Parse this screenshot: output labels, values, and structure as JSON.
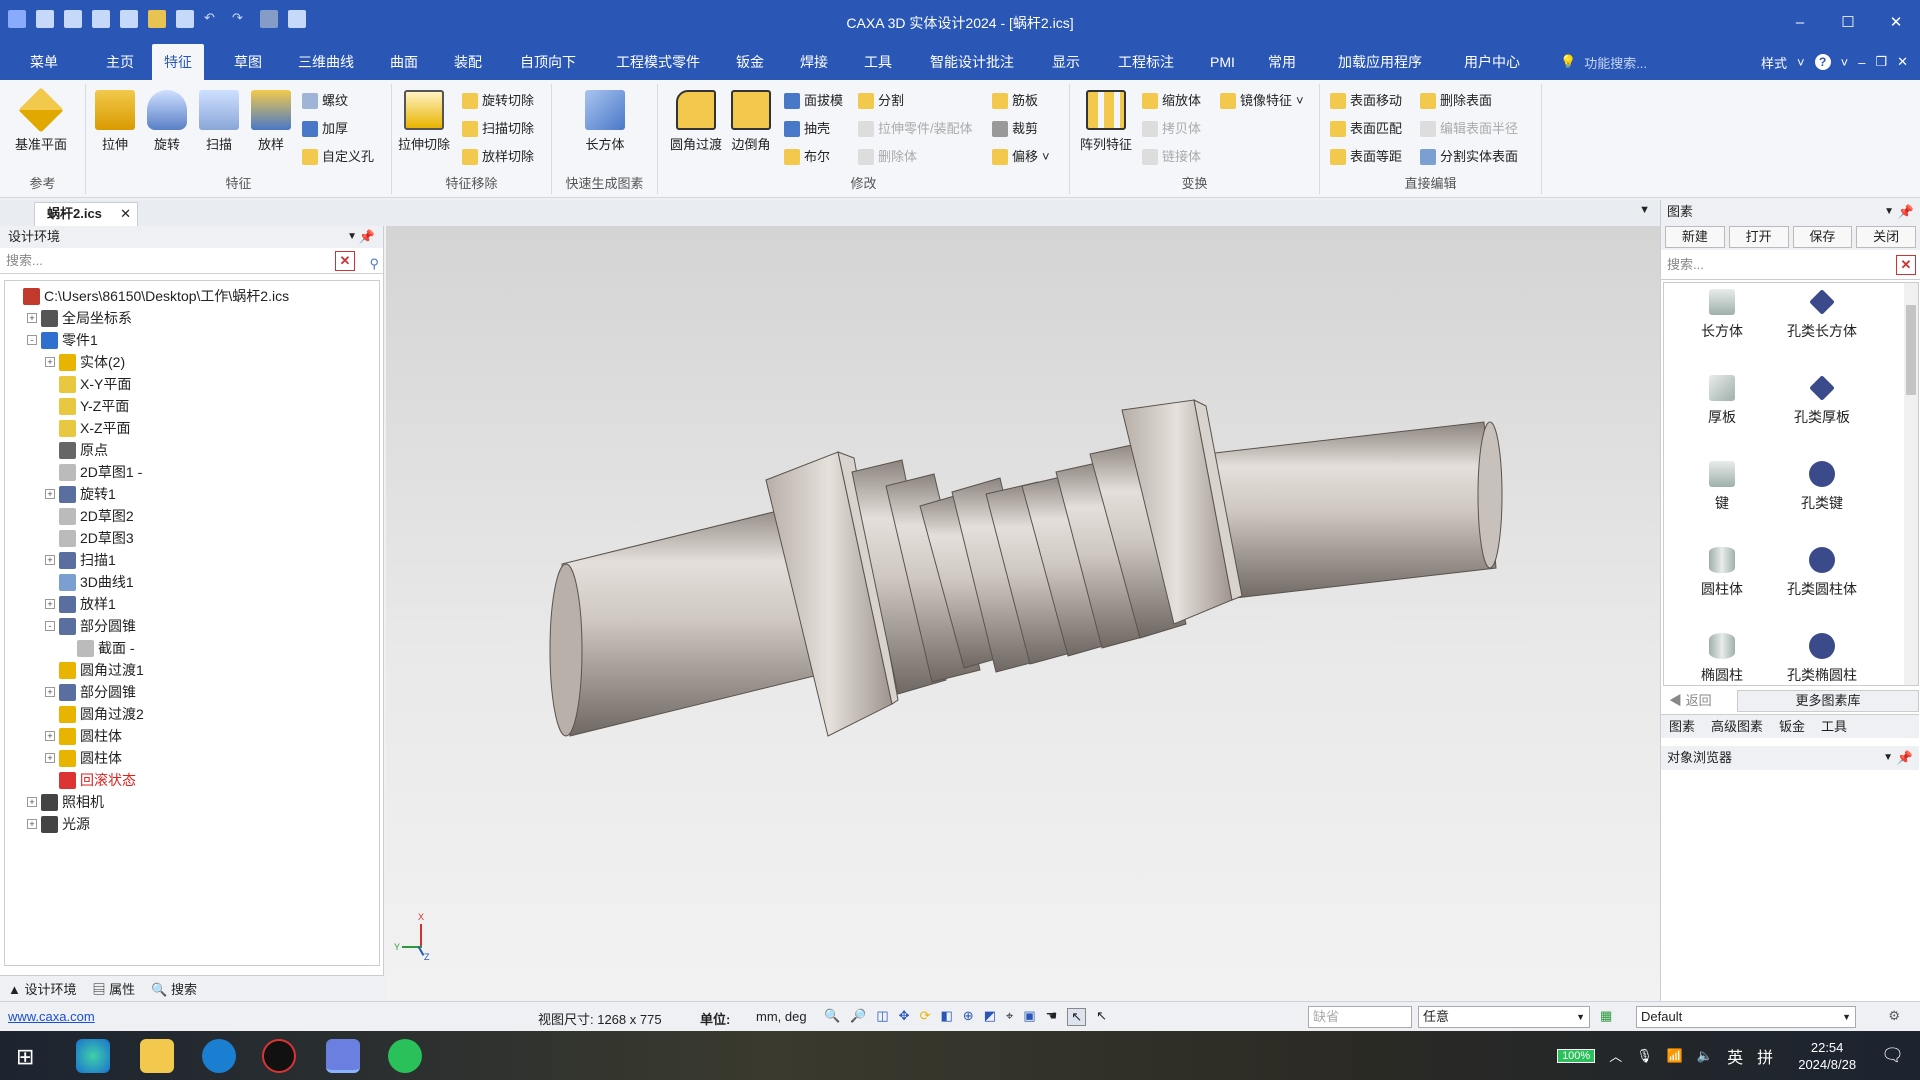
{
  "window": {
    "title": "CAXA 3D 实体设计2024 - [蜗杆2.ics]",
    "minimize": "–",
    "maximize": "☐",
    "close": "✕"
  },
  "menu": {
    "tabs": [
      "菜单",
      "主页",
      "特征",
      "草图",
      "三维曲线",
      "曲面",
      "装配",
      "自顶向下",
      "工程模式零件",
      "钣金",
      "焊接",
      "工具",
      "智能设计批注",
      "显示",
      "工程标注",
      "PMI",
      "常用",
      "加载应用程序",
      "用户中心"
    ],
    "active": "特征",
    "search_placeholder": "功能搜索...",
    "style_label": "样式"
  },
  "ribbon": {
    "groups": {
      "ref": "参考",
      "feature": "特征",
      "remove": "特征移除",
      "quick": "快速生成图素",
      "modify": "修改",
      "transform": "变换",
      "direct": "直接编辑"
    },
    "ref_big": "基准平面",
    "feature_big": [
      "拉伸",
      "旋转",
      "扫描",
      "放样"
    ],
    "feature_small": [
      "螺纹",
      "加厚",
      "自定义孔"
    ],
    "remove_big": "拉伸切除",
    "remove_small": [
      "旋转切除",
      "扫描切除",
      "放样切除"
    ],
    "quick_big": "长方体",
    "modify_big": [
      "圆角过渡",
      "边倒角"
    ],
    "modify_small_a": [
      "面拔模",
      "抽壳",
      "布尔"
    ],
    "modify_small_b": [
      "分割",
      "拉伸零件/装配体",
      "删除体"
    ],
    "modify_small_c": [
      "筋板",
      "裁剪",
      "偏移"
    ],
    "transform_big": "阵列特征",
    "transform_small": [
      "缩放体",
      "拷贝体",
      "链接体"
    ],
    "mirror": "镜像特征",
    "direct_small_a": [
      "表面移动",
      "表面匹配",
      "表面等距"
    ],
    "direct_small_b": [
      "删除表面",
      "编辑表面半径",
      "分割实体表面"
    ]
  },
  "doc_tab": "蜗杆2.ics",
  "design_env": {
    "title": "设计环境",
    "search_placeholder": "搜索...",
    "tree": [
      {
        "label": "C:\\Users\\86150\\Desktop\\工作\\蜗杆2.ics",
        "level": 0,
        "pm": "",
        "icon": "#c0392b"
      },
      {
        "label": "全局坐标系",
        "level": 1,
        "pm": "+",
        "icon": "#555"
      },
      {
        "label": "零件1",
        "level": 1,
        "pm": "-",
        "icon": "#2f6fcf"
      },
      {
        "label": "实体(2)",
        "level": 2,
        "pm": "+",
        "icon": "#e8b400"
      },
      {
        "label": "X-Y平面",
        "level": 2,
        "pm": "",
        "icon": "#e8c840"
      },
      {
        "label": "Y-Z平面",
        "level": 2,
        "pm": "",
        "icon": "#e8c840"
      },
      {
        "label": "X-Z平面",
        "level": 2,
        "pm": "",
        "icon": "#e8c840"
      },
      {
        "label": "原点",
        "level": 2,
        "pm": "",
        "icon": "#666"
      },
      {
        "label": "2D草图1 -",
        "level": 2,
        "pm": "",
        "icon": "#bbb"
      },
      {
        "label": "旋转1",
        "level": 2,
        "pm": "+",
        "icon": "#5a6fa0"
      },
      {
        "label": "2D草图2",
        "level": 2,
        "pm": "",
        "icon": "#bbb"
      },
      {
        "label": "2D草图3",
        "level": 2,
        "pm": "",
        "icon": "#bbb"
      },
      {
        "label": "扫描1",
        "level": 2,
        "pm": "+",
        "icon": "#5a6fa0"
      },
      {
        "label": "3D曲线1",
        "level": 2,
        "pm": "",
        "icon": "#7a9fd0"
      },
      {
        "label": "放样1",
        "level": 2,
        "pm": "+",
        "icon": "#5a6fa0"
      },
      {
        "label": "部分圆锥",
        "level": 2,
        "pm": "-",
        "icon": "#5a6fa0"
      },
      {
        "label": "截面 -",
        "level": 3,
        "pm": "",
        "icon": "#bbb"
      },
      {
        "label": "圆角过渡1",
        "level": 2,
        "pm": "",
        "icon": "#e8b400"
      },
      {
        "label": "部分圆锥",
        "level": 2,
        "pm": "+",
        "icon": "#5a6fa0"
      },
      {
        "label": "圆角过渡2",
        "level": 2,
        "pm": "",
        "icon": "#e8b400"
      },
      {
        "label": "圆柱体",
        "level": 2,
        "pm": "+",
        "icon": "#e8b400"
      },
      {
        "label": "圆柱体",
        "level": 2,
        "pm": "+",
        "icon": "#e8b400"
      },
      {
        "label": "回滚状态",
        "level": 2,
        "pm": "",
        "icon": "#d33",
        "red": true
      },
      {
        "label": "照相机",
        "level": 1,
        "pm": "+",
        "icon": "#444"
      },
      {
        "label": "光源",
        "level": 1,
        "pm": "+",
        "icon": "#444"
      }
    ],
    "footer_tabs": [
      "设计环境",
      "属性",
      "搜索"
    ]
  },
  "library": {
    "title": "图素",
    "buttons": [
      "新建",
      "打开",
      "保存",
      "关闭"
    ],
    "search_placeholder": "搜索...",
    "items": [
      "长方体",
      "孔类长方体",
      "厚板",
      "孔类厚板",
      "键",
      "孔类键",
      "圆柱体",
      "孔类圆柱体",
      "椭圆柱",
      "孔类椭圆柱"
    ],
    "back": "返回",
    "more": "更多图素库",
    "tabs": [
      "图素",
      "高级图素",
      "钣金",
      "工具"
    ],
    "object_browser": "对象浏览器"
  },
  "axes": {
    "x": "X",
    "y": "Y",
    "z": "Z"
  },
  "status": {
    "website": "www.caxa.com",
    "view_size": "视图尺寸: 1268 x 775",
    "unit_label": "单位:",
    "unit_value": "mm, deg",
    "combo1": "缺省",
    "combo2": "任意",
    "combo3": "Default"
  },
  "taskbar": {
    "battery": "100%",
    "ime": "英",
    "ime2": "拼",
    "time": "22:54",
    "date": "2024/8/28"
  }
}
